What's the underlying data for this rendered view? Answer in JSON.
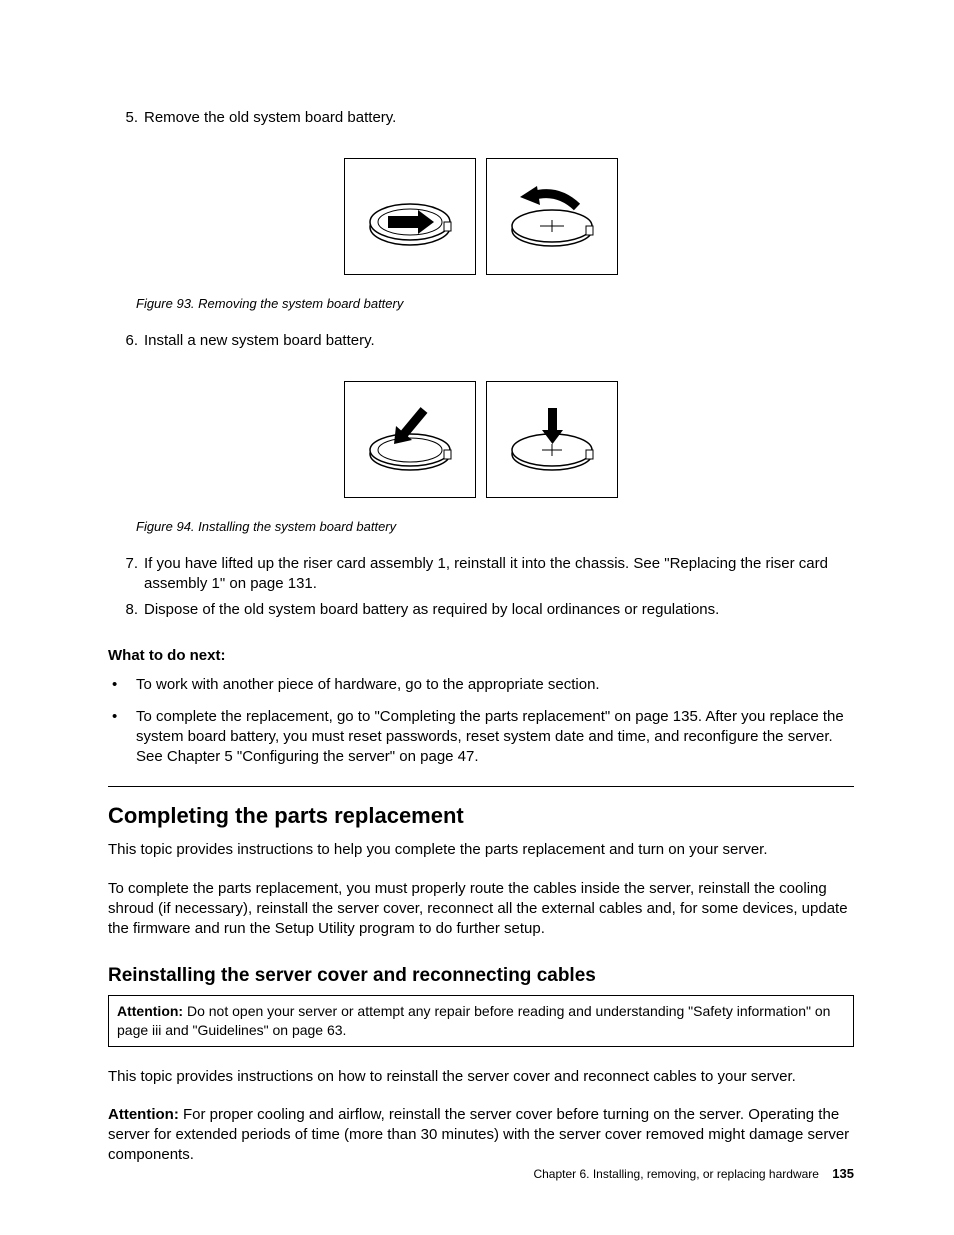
{
  "steps": {
    "s5": {
      "num": "5.",
      "text": "Remove the old system board battery."
    },
    "s6": {
      "num": "6.",
      "text": "Install a new system board battery."
    },
    "s7": {
      "num": "7.",
      "text": "If you have lifted up the riser card assembly 1, reinstall it into the chassis. See \"Replacing the riser card assembly 1\" on page 131."
    },
    "s8": {
      "num": "8.",
      "text": "Dispose of the old system board battery as required by local ordinances or regulations."
    }
  },
  "figures": {
    "f93": "Figure 93. Removing the system board battery",
    "f94": "Figure 94. Installing the system board battery"
  },
  "what_next": {
    "heading": "What to do next:",
    "b1": "To work with another piece of hardware, go to the appropriate section.",
    "b2": "To complete the replacement, go to \"Completing the parts replacement\" on page 135. After you replace the system board battery, you must reset passwords, reset system date and time, and reconfigure the server. See Chapter 5 \"Configuring the server\" on page 47."
  },
  "section1": {
    "title": "Completing the parts replacement",
    "p1": "This topic provides instructions to help you complete the parts replacement and turn on your server.",
    "p2": "To complete the parts replacement, you must properly route the cables inside the server, reinstall the cooling shroud (if necessary), reinstall the server cover, reconnect all the external cables and, for some devices, update the firmware and run the Setup Utility program to do further setup."
  },
  "section2": {
    "title": "Reinstalling the server cover and reconnecting cables",
    "box_label": "Attention:",
    "box_text": " Do not open your server or attempt any repair before reading and understanding \"Safety information\" on page iii and \"Guidelines\" on page 63.",
    "p1": "This topic provides instructions on how to reinstall the server cover and reconnect cables to your server.",
    "att2_label": "Attention:",
    "att2_text": " For proper cooling and airflow, reinstall the server cover before turning on the server. Operating the server for extended periods of time (more than 30 minutes) with the server cover removed might damage server components."
  },
  "footer": {
    "chapter": "Chapter 6. Installing, removing, or replacing hardware",
    "page": "135"
  }
}
